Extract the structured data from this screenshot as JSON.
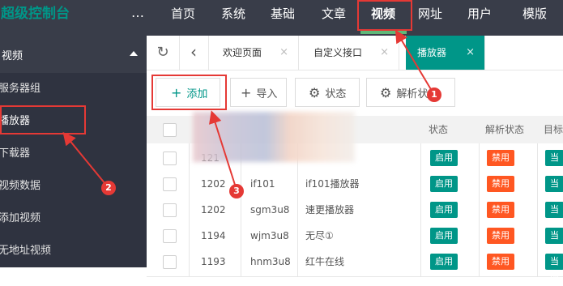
{
  "topbar": {
    "brand": "超级控制台",
    "more_icon": "…",
    "nav": [
      {
        "label": "首页"
      },
      {
        "label": "系统"
      },
      {
        "label": "基础"
      },
      {
        "label": "文章"
      },
      {
        "label": "视频"
      },
      {
        "label": "网址"
      },
      {
        "label": "用户"
      },
      {
        "label": "模版"
      }
    ],
    "active_nav": "视频"
  },
  "sidebar": {
    "section": "视频",
    "items": [
      {
        "label": "服务器组"
      },
      {
        "label": "播放器"
      },
      {
        "label": "下载器"
      },
      {
        "label": "视频数据"
      },
      {
        "label": "添加视频"
      },
      {
        "label": "无地址视频"
      }
    ]
  },
  "tabs": {
    "refresh_icon": "↻",
    "back_icon": "‹",
    "items": [
      {
        "label": "欢迎页面",
        "close": "×"
      },
      {
        "label": "自定义接口",
        "close": "×"
      },
      {
        "label": "播放器",
        "close": "×"
      }
    ]
  },
  "toolbar": {
    "add": "添加",
    "add_icon": "+",
    "import": "导入",
    "import_icon": "+",
    "status": "状态",
    "status_icon": "⚙",
    "parse": "解析状",
    "parse_icon": "⚙"
  },
  "table": {
    "headers": {
      "status": "状态",
      "parse_status": "解析状态",
      "target": "目标"
    },
    "rows": [
      {
        "id": "121",
        "code": "",
        "name": "",
        "status": "启用",
        "parse": "禁用",
        "target": "当前"
      },
      {
        "id": "1202",
        "code": "if101",
        "name": "if101播放器",
        "status": "启用",
        "parse": "禁用",
        "target": "当前"
      },
      {
        "id": "1202",
        "code": "sgm3u8",
        "name": "速更播放器",
        "status": "启用",
        "parse": "禁用",
        "target": "当前"
      },
      {
        "id": "1194",
        "code": "wjm3u8",
        "name": "无尽①",
        "status": "启用",
        "parse": "禁用",
        "target": "当前"
      },
      {
        "id": "1193",
        "code": "hnm3u8",
        "name": "红牛在线",
        "status": "启用",
        "parse": "禁用",
        "target": "当前"
      }
    ]
  },
  "annotations": {
    "one": "1",
    "two": "2",
    "three": "3"
  },
  "colors": {
    "accent": "#009688",
    "danger": "#FF5722",
    "annotation": "#e53935",
    "dark": "#393D49"
  }
}
